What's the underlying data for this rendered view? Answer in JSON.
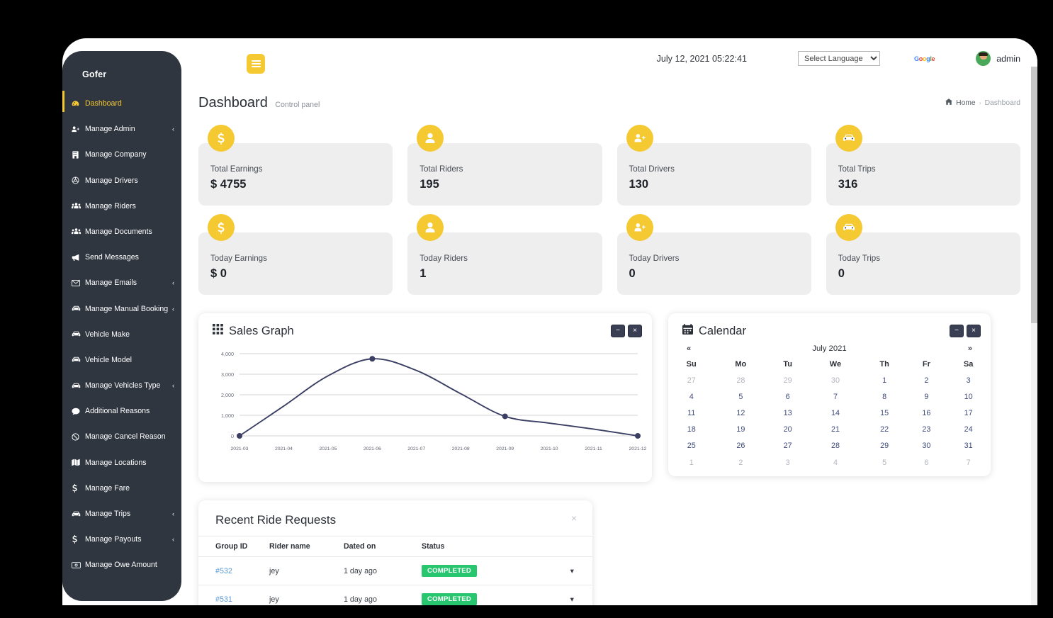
{
  "brand": "Gofer",
  "sidebar": {
    "items": [
      {
        "label": "Dashboard",
        "icon": "dashboard-icon",
        "active": true,
        "caret": false
      },
      {
        "label": "Manage Admin",
        "icon": "user-plus-icon",
        "active": false,
        "caret": true
      },
      {
        "label": "Manage Company",
        "icon": "building-icon",
        "active": false,
        "caret": false
      },
      {
        "label": "Manage Drivers",
        "icon": "steering-wheel-icon",
        "active": false,
        "caret": false
      },
      {
        "label": "Manage Riders",
        "icon": "users-icon",
        "active": false,
        "caret": false
      },
      {
        "label": "Manage Documents",
        "icon": "users-icon",
        "active": false,
        "caret": false
      },
      {
        "label": "Send Messages",
        "icon": "megaphone-icon",
        "active": false,
        "caret": false
      },
      {
        "label": "Manage Emails",
        "icon": "envelope-icon",
        "active": false,
        "caret": true
      },
      {
        "label": "Manage Manual Booking",
        "icon": "taxi-icon",
        "active": false,
        "caret": true
      },
      {
        "label": "Vehicle Make",
        "icon": "taxi-icon",
        "active": false,
        "caret": false
      },
      {
        "label": "Vehicle Model",
        "icon": "taxi-icon",
        "active": false,
        "caret": false
      },
      {
        "label": "Manage Vehicles Type",
        "icon": "taxi-icon",
        "active": false,
        "caret": true
      },
      {
        "label": "Additional Reasons",
        "icon": "comment-icon",
        "active": false,
        "caret": false
      },
      {
        "label": "Manage Cancel Reason",
        "icon": "ban-icon",
        "active": false,
        "caret": false
      },
      {
        "label": "Manage Locations",
        "icon": "map-icon",
        "active": false,
        "caret": false
      },
      {
        "label": "Manage Fare",
        "icon": "dollar-icon",
        "active": false,
        "caret": false
      },
      {
        "label": "Manage Trips",
        "icon": "taxi-icon",
        "active": false,
        "caret": true
      },
      {
        "label": "Manage Payouts",
        "icon": "dollar-icon",
        "active": false,
        "caret": true
      },
      {
        "label": "Manage Owe Amount",
        "icon": "money-bill-icon",
        "active": false,
        "caret": false
      }
    ]
  },
  "topbar": {
    "menu_icon": "hamburger-icon",
    "datetime": "July 12, 2021 05:22:41",
    "language_selected": "Select Language",
    "language_options": [
      "Select Language"
    ],
    "google_logo": "Google",
    "username": "admin",
    "avatar_icon": "user-avatar"
  },
  "page": {
    "title": "Dashboard",
    "subtitle": "Control panel",
    "breadcrumb": {
      "home": "Home",
      "separator": "›",
      "current": "Dashboard"
    }
  },
  "stats": {
    "row1": [
      {
        "label": "Total Earnings",
        "value": "$ 4755",
        "icon": "dollar-icon"
      },
      {
        "label": "Total Riders",
        "value": "195",
        "icon": "user-icon"
      },
      {
        "label": "Total Drivers",
        "value": "130",
        "icon": "user-plus-icon"
      },
      {
        "label": "Total Trips",
        "value": "316",
        "icon": "taxi-icon"
      }
    ],
    "row2": [
      {
        "label": "Today Earnings",
        "value": "$ 0",
        "icon": "dollar-icon"
      },
      {
        "label": "Today Riders",
        "value": "1",
        "icon": "user-icon"
      },
      {
        "label": "Today Drivers",
        "value": "0",
        "icon": "user-plus-icon"
      },
      {
        "label": "Today Trips",
        "value": "0",
        "icon": "taxi-icon"
      }
    ]
  },
  "sales_panel": {
    "title": "Sales Graph",
    "title_icon": "grid-icon",
    "minimize_label": "−",
    "close_label": "×"
  },
  "chart_data": {
    "type": "line",
    "title": "Sales Graph",
    "x": [
      "2021-03",
      "2021-04",
      "2021-05",
      "2021-06",
      "2021-07",
      "2021-08",
      "2021-09",
      "2021-10",
      "2021-11",
      "2021-12"
    ],
    "xlabel": "",
    "ylabel": "",
    "ylim": [
      0,
      4000
    ],
    "yticks": [
      0,
      1000,
      2000,
      3000,
      4000
    ],
    "ytick_labels": [
      "0",
      "1,000",
      "2,000",
      "3,000",
      "4,000"
    ],
    "grid": true,
    "legend": false,
    "series": [
      {
        "name": "Sales",
        "color": "#3b3f63",
        "markers_at": [
          "2021-03",
          "2021-06",
          "2021-09",
          "2021-12"
        ],
        "values": [
          0,
          1450,
          2920,
          3750,
          3180,
          2050,
          950,
          620,
          330,
          0
        ]
      }
    ]
  },
  "calendar_panel": {
    "title": "Calendar",
    "title_icon": "calendar-icon",
    "minimize_label": "−",
    "close_label": "×",
    "prev_label": "«",
    "next_label": "»",
    "month_label": "July 2021",
    "weekdays": [
      "Su",
      "Mo",
      "Tu",
      "We",
      "Th",
      "Fr",
      "Sa"
    ],
    "weeks": [
      [
        {
          "d": "27",
          "muted": true
        },
        {
          "d": "28",
          "muted": true
        },
        {
          "d": "29",
          "muted": true
        },
        {
          "d": "30",
          "muted": true
        },
        {
          "d": "1",
          "muted": false
        },
        {
          "d": "2",
          "muted": false
        },
        {
          "d": "3",
          "muted": false
        }
      ],
      [
        {
          "d": "4",
          "muted": false
        },
        {
          "d": "5",
          "muted": false
        },
        {
          "d": "6",
          "muted": false
        },
        {
          "d": "7",
          "muted": false
        },
        {
          "d": "8",
          "muted": false
        },
        {
          "d": "9",
          "muted": false
        },
        {
          "d": "10",
          "muted": false
        }
      ],
      [
        {
          "d": "11",
          "muted": false
        },
        {
          "d": "12",
          "muted": false
        },
        {
          "d": "13",
          "muted": false
        },
        {
          "d": "14",
          "muted": false
        },
        {
          "d": "15",
          "muted": false
        },
        {
          "d": "16",
          "muted": false
        },
        {
          "d": "17",
          "muted": false
        }
      ],
      [
        {
          "d": "18",
          "muted": false
        },
        {
          "d": "19",
          "muted": false
        },
        {
          "d": "20",
          "muted": false
        },
        {
          "d": "21",
          "muted": false
        },
        {
          "d": "22",
          "muted": false
        },
        {
          "d": "23",
          "muted": false
        },
        {
          "d": "24",
          "muted": false
        }
      ],
      [
        {
          "d": "25",
          "muted": false
        },
        {
          "d": "26",
          "muted": false
        },
        {
          "d": "27",
          "muted": false
        },
        {
          "d": "28",
          "muted": false
        },
        {
          "d": "29",
          "muted": false
        },
        {
          "d": "30",
          "muted": false
        },
        {
          "d": "31",
          "muted": false
        }
      ],
      [
        {
          "d": "1",
          "muted": true
        },
        {
          "d": "2",
          "muted": true
        },
        {
          "d": "3",
          "muted": true
        },
        {
          "d": "4",
          "muted": true
        },
        {
          "d": "5",
          "muted": true
        },
        {
          "d": "6",
          "muted": true
        },
        {
          "d": "7",
          "muted": true
        }
      ]
    ]
  },
  "recent_requests": {
    "title": "Recent Ride Requests",
    "close_label": "×",
    "columns": [
      "Group ID",
      "Rider name",
      "Dated on",
      "Status",
      ""
    ],
    "rows": [
      {
        "group_id": "#532",
        "rider": "jey",
        "dated": "1 day ago",
        "status": "COMPLETED",
        "caret": "▾"
      },
      {
        "group_id": "#531",
        "rider": "jey",
        "dated": "1 day ago",
        "status": "COMPLETED",
        "caret": "▾"
      }
    ]
  },
  "colors": {
    "accent": "#f5c932",
    "sidebar_bg": "#2f3640",
    "card_bg": "#eeeeee",
    "status_completed": "#28c76f",
    "chart_line": "#3b3f63",
    "link": "#5b9bd5"
  }
}
